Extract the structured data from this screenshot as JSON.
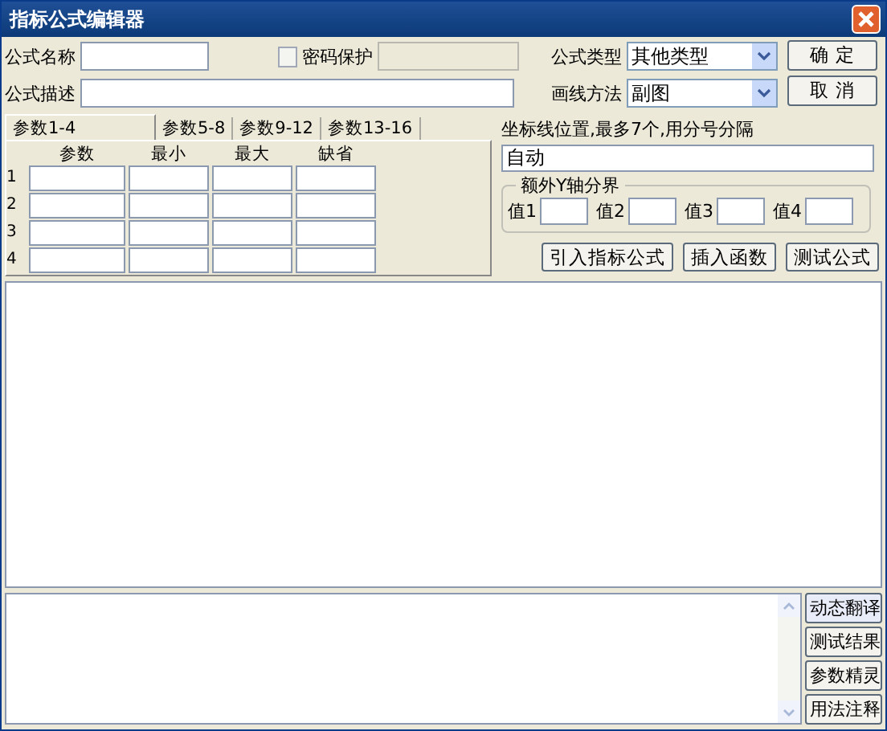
{
  "window": {
    "title": "指标公式编辑器"
  },
  "form": {
    "name_label": "公式名称",
    "password": {
      "label": "密码保护",
      "checked": false
    },
    "description_label": "公式描述",
    "type": {
      "label": "公式类型",
      "value": "其他类型"
    },
    "draw_method": {
      "label": "画线方法",
      "value": "副图"
    }
  },
  "buttons": {
    "ok": "确 定",
    "cancel": "取 消"
  },
  "param_tabs": [
    {
      "label": "参数1-4",
      "selected": true
    },
    {
      "label": "参数5-8",
      "selected": false
    },
    {
      "label": "参数9-12",
      "selected": false
    },
    {
      "label": "参数13-16",
      "selected": false
    }
  ],
  "param_columns": [
    "参数",
    "最小",
    "最大",
    "缺省"
  ],
  "param_rows": [
    "1",
    "2",
    "3",
    "4"
  ],
  "axis": {
    "label": "坐标线位置,最多7个,用分号分隔",
    "value": "自动"
  },
  "y_bounds": {
    "title": "额外Y轴分界",
    "fields": [
      "值1",
      "值2",
      "值3",
      "值4"
    ]
  },
  "tool_buttons": [
    "引入指标公式",
    "插入函数",
    "测试公式"
  ],
  "side_buttons": [
    "动态翻译",
    "测试结果",
    "参数精灵",
    "用法注释"
  ]
}
